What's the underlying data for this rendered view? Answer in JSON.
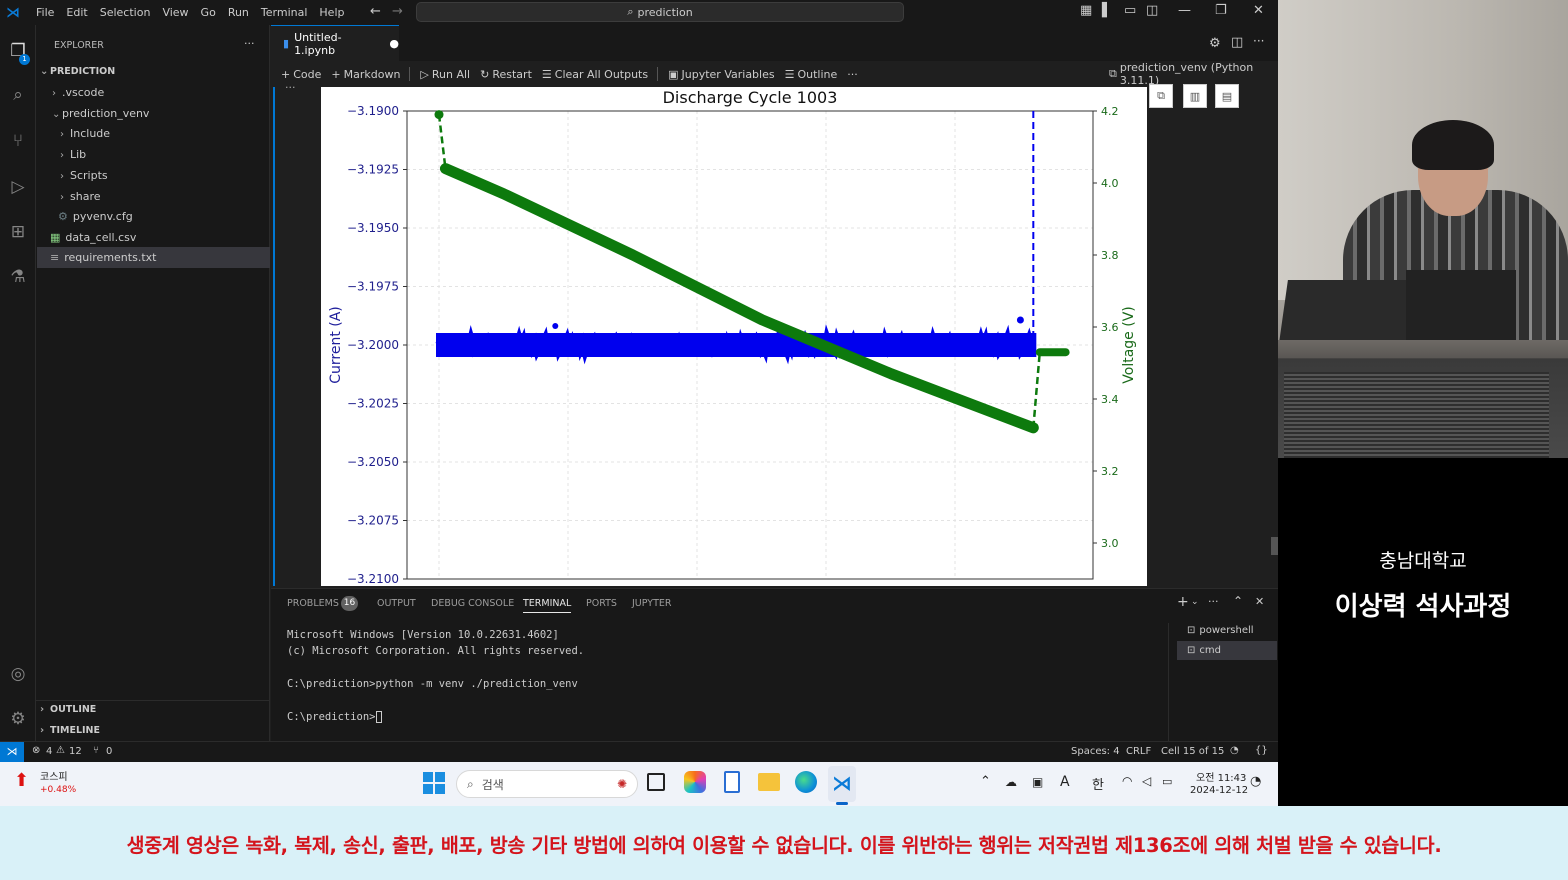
{
  "menu": [
    "File",
    "Edit",
    "Selection",
    "View",
    "Go",
    "Run",
    "Terminal",
    "Help"
  ],
  "search": {
    "text": "prediction"
  },
  "explorer": {
    "title": "EXPLORER",
    "root": "PREDICTION",
    "items": [
      ".vscode",
      "prediction_venv",
      "Include",
      "Lib",
      "Scripts",
      "share",
      "pyvenv.cfg",
      "data_cell.csv",
      "requirements.txt"
    ],
    "outline": "OUTLINE",
    "timeline": "TIMELINE"
  },
  "tab": {
    "title": "Untitled-1.ipynb"
  },
  "toolbar": {
    "code": "Code",
    "markdown": "Markdown",
    "run_all": "Run All",
    "restart": "Restart",
    "clear": "Clear All Outputs",
    "variables": "Jupyter Variables",
    "outline": "Outline",
    "kernel": "prediction_venv (Python 3.11.1)"
  },
  "chart_data": {
    "type": "line",
    "title": "Discharge Cycle 1003",
    "ylabel": "Current (A)",
    "y2label": "Voltage (V)",
    "ylim": [
      -3.21,
      -3.19
    ],
    "y2lim": [
      2.9,
      4.2
    ],
    "y_ticks": [
      "−3.1900",
      "−3.1925",
      "−3.1950",
      "−3.1975",
      "−3.2000",
      "−3.2025",
      "−3.2050",
      "−3.2075",
      "−3.2100"
    ],
    "y2_ticks": [
      "4.2",
      "4.0",
      "3.8",
      "3.6",
      "3.4",
      "3.2",
      "3.0"
    ],
    "series": [
      {
        "color": "#0000ee",
        "axis": "left",
        "x": [
          0,
          0.25,
          0.5,
          0.75,
          0.9,
          0.92
        ],
        "values": [
          -3.2,
          -3.2,
          -3.2,
          -3.2,
          -3.2,
          -3.2
        ]
      },
      {
        "color": "#0d7a0d",
        "axis": "right",
        "x": [
          0,
          0.01,
          0.1,
          0.3,
          0.5,
          0.7,
          0.92,
          0.93,
          0.97
        ],
        "values": [
          4.19,
          4.04,
          3.97,
          3.8,
          3.62,
          3.47,
          3.32,
          3.53,
          3.53
        ]
      }
    ]
  },
  "panel": {
    "tabs": [
      "PROBLEMS",
      "OUTPUT",
      "DEBUG CONSOLE",
      "TERMINAL",
      "PORTS",
      "JUPYTER"
    ],
    "problems_count": "16",
    "terminal_lines": [
      "Microsoft Windows [Version 10.0.22631.4602]",
      "(c) Microsoft Corporation. All rights reserved.",
      "",
      "C:\\prediction>python -m venv ./prediction_venv",
      "",
      "C:\\prediction>"
    ],
    "shells": [
      "powershell",
      "cmd"
    ]
  },
  "status": {
    "errors": "4",
    "warnings": "12",
    "ports": "0",
    "spaces": "Spaces: 4",
    "eol": "CRLF",
    "cell": "Cell 15 of 15"
  },
  "taskbar": {
    "stock_name": "코스피",
    "stock_change": "+0.48%",
    "search_placeholder": "검색",
    "time": "오전 11:43",
    "date": "2024-12-12",
    "ime": "한",
    "lang": "A"
  },
  "namecard": {
    "school": "충남대학교",
    "name": "이상력 석사과정"
  },
  "banner": "생중계 영상은 녹화, 복제, 송신, 출판, 배포, 방송 기타 방법에 의하여 이용할 수 없습니다. 이를 위반하는 행위는 저작권법 제136조에 의해 처벌 받을 수  있습니다."
}
